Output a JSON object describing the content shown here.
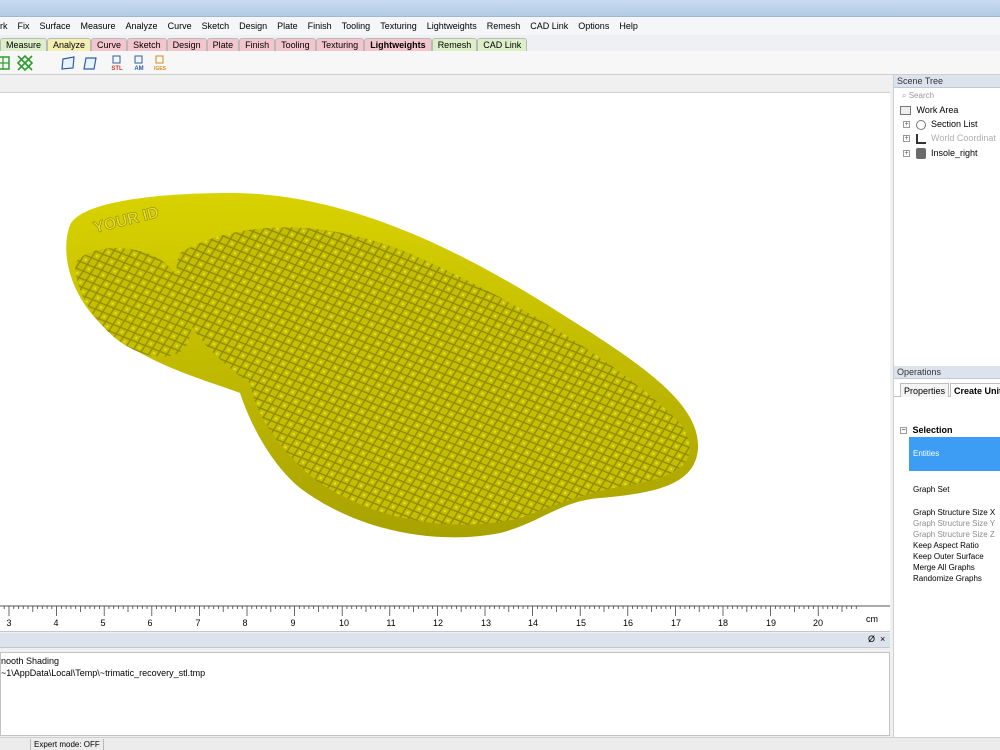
{
  "menu": [
    "rk",
    "Fix",
    "Surface",
    "Measure",
    "Analyze",
    "Curve",
    "Sketch",
    "Design",
    "Plate",
    "Finish",
    "Tooling",
    "Texturing",
    "Lightweights",
    "Remesh",
    "CAD Link",
    "Options",
    "Help"
  ],
  "tabs": [
    {
      "label": "Measure",
      "color": "green"
    },
    {
      "label": "Analyze",
      "color": "yellow"
    },
    {
      "label": "Curve",
      "color": "pink"
    },
    {
      "label": "Sketch",
      "color": "pink"
    },
    {
      "label": "Design",
      "color": "pink"
    },
    {
      "label": "Plate",
      "color": "pink"
    },
    {
      "label": "Finish",
      "color": "pink"
    },
    {
      "label": "Tooling",
      "color": "pink"
    },
    {
      "label": "Texturing",
      "color": "pink"
    },
    {
      "label": "Lightweights",
      "color": "pink",
      "active": true
    },
    {
      "label": "Remesh",
      "color": "green"
    },
    {
      "label": "CAD Link",
      "color": "green"
    }
  ],
  "toolbar": {
    "icons": [
      "mesh-grid-icon",
      "lattice-icon",
      "plane-icon",
      "plane-alt-icon",
      "stl-export-icon",
      "amf-export-icon",
      "iges-export-icon"
    ],
    "stl_label": "STL",
    "amf_label": "AM",
    "iges_label": "IGES"
  },
  "model": {
    "emboss_text": "YOUR ID",
    "fill_color": "#c9c300",
    "shade_color": "#a39e00"
  },
  "ruler": {
    "ticks": [
      "3",
      "4",
      "5",
      "6",
      "7",
      "8",
      "9",
      "10",
      "11",
      "12",
      "13",
      "14",
      "15",
      "16",
      "17",
      "18",
      "19",
      "20"
    ],
    "unit": "cm"
  },
  "lower_bar": {
    "pin": "Ø",
    "close": "×"
  },
  "log": {
    "lines": [
      "nooth Shading",
      "~1\\AppData\\Local\\Temp\\~trimatic_recovery_stl.tmp"
    ]
  },
  "status": {
    "expert_mode": "Expert mode: OFF"
  },
  "scene_tree": {
    "title": "Scene Tree",
    "search_placeholder": "Search",
    "root": "Work Area",
    "items": [
      {
        "label": "Section List"
      },
      {
        "label": "World Coordinat",
        "dim": true
      },
      {
        "label": "Insole_right"
      }
    ]
  },
  "operations": {
    "title": "Operations",
    "tabs": [
      "Properties",
      "Create Unit"
    ],
    "section": "Selection",
    "entities": "Entities",
    "graph_set": "Graph Set",
    "options": [
      {
        "label": "Graph Structure Size X",
        "dim": false
      },
      {
        "label": "Graph Structure Size Y",
        "dim": true
      },
      {
        "label": "Graph Structure Size Z",
        "dim": true
      },
      {
        "label": "Keep Aspect Ratio",
        "dim": false
      },
      {
        "label": "Keep Outer Surface",
        "dim": false
      },
      {
        "label": "Merge All Graphs",
        "dim": false
      },
      {
        "label": "Randomize Graphs",
        "dim": false
      }
    ]
  },
  "colors": {
    "accent": "#3d9df5",
    "model_yellow": "#c9c300"
  }
}
